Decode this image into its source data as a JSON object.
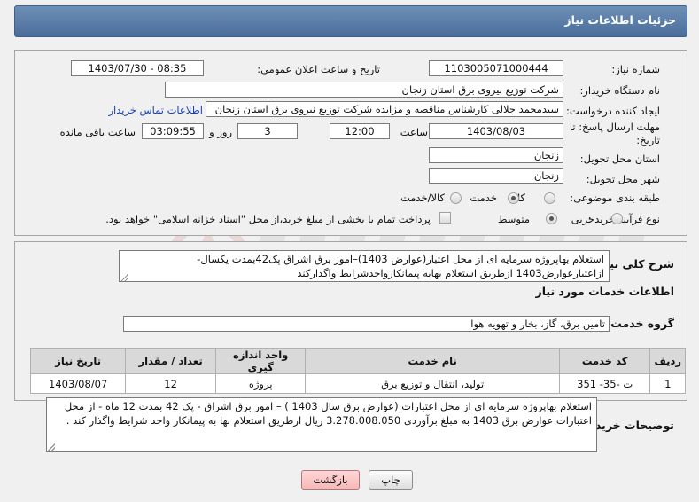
{
  "header": {
    "title": "جزئیات اطلاعات نیاز"
  },
  "info": {
    "need_number_label": "شماره نیاز:",
    "need_number": "1103005071000444",
    "announce_label": "تاریخ و ساعت اعلان عمومی:",
    "announce_value": "1403/07/30 - 08:35",
    "buyer_org_label": "نام دستگاه خریدار:",
    "buyer_org": "شرکت توزیع نیروی برق استان زنجان",
    "requester_label": "ایجاد کننده درخواست:",
    "requester": "سیدمحمد جلالی کارشناس مناقصه و مزایده شرکت توزیع نیروی برق استان زنجان",
    "contact_link": "اطلاعات تماس خریدار",
    "deadline_label_1": "مهلت ارسال پاسخ: تا",
    "deadline_label_2": "تاریخ:",
    "deadline_date": "1403/08/03",
    "time_label": "ساعت",
    "deadline_time": "12:00",
    "days_value": "3",
    "days_label": "روز و",
    "remaining_time": "03:09:55",
    "remaining_label": "ساعت باقی مانده",
    "province_label": "استان محل تحویل:",
    "province": "زنجان",
    "city_label": "شهر محل تحویل:",
    "city": "زنجان",
    "category_label": "طبقه بندی موضوعی:",
    "category_options": [
      "کالا",
      "خدمت",
      "کالا/خدمت"
    ],
    "category_selected": "خدمت",
    "process_label": "نوع فرآیند خرید :",
    "process_options": [
      "جزیی",
      "متوسط"
    ],
    "process_selected": "متوسط",
    "payment_note": "پرداخت تمام یا بخشی از مبلغ خرید،از محل \"اسناد خزانه اسلامی\" خواهد بود."
  },
  "summary": {
    "label": "شرح کلی نیاز:",
    "text": "استعلام بهاپروژه سرمایه ای از محل اعتبار(عوارض 1403)–امور برق اشراق پک42بمدت یکسال-ازاعتبارعوارض1403 ازطریق استعلام بهابه پیمانکارواجدشرایط واگذارکند"
  },
  "services": {
    "section_title": "اطلاعات خدمات مورد نیاز",
    "group_label": "گروه خدمت:",
    "group_value": "تامین برق، گاز، بخار و تهویه هوا",
    "columns": [
      "ردیف",
      "کد خدمت",
      "نام خدمت",
      "واحد اندازه گیری",
      "تعداد / مقدار",
      "تاریخ نیاز"
    ],
    "rows": [
      [
        "1",
        "ت -35- 351",
        "تولید، انتقال و توزیع برق",
        "پروژه",
        "12",
        "1403/08/07"
      ]
    ]
  },
  "buyer_notes": {
    "label": "توضیحات خریدار:",
    "text": "استعلام بهاپروژه سرمایه ای از محل اعتبارات (عوارض برق سال 1403 ) – امور برق اشراق - پک 42 بمدت 12 ماه -  از محل اعتبارات عوارض برق 1403 به مبلغ برآوردی 3.278.008.050 ریال ازطریق استعلام بها به پیمانکار واجد شرایط واگذار کند ."
  },
  "buttons": {
    "print": "چاپ",
    "back": "بازگشت"
  },
  "colors": {
    "header": "#4a6e9c",
    "link": "#1a3fb0",
    "back_button": "#f7b9b9"
  }
}
